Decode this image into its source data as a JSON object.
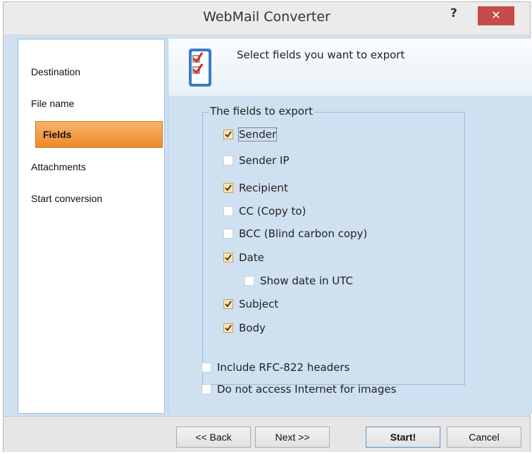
{
  "window": {
    "title": "WebMail Converter",
    "help_label": "?",
    "close_label": "✕"
  },
  "sidebar": {
    "items": [
      {
        "label": "Destination"
      },
      {
        "label": "File name"
      },
      {
        "label": "Fields",
        "active": true
      },
      {
        "label": "Attachments"
      },
      {
        "label": "Start conversion"
      }
    ]
  },
  "header": {
    "icon": "checklist-icon",
    "text": "Select fields you want to export"
  },
  "fields_group": {
    "legend": "The fields to export",
    "options": [
      {
        "label": "Sender",
        "checked": true
      },
      {
        "label": "Sender IP",
        "checked": false
      },
      {
        "label": "Recipient",
        "checked": true
      },
      {
        "label": "CC (Copy to)",
        "checked": false
      },
      {
        "label": "BCC (Blind carbon copy)",
        "checked": false
      },
      {
        "label": "Date",
        "checked": true
      },
      {
        "label": "Show date in UTC",
        "checked": false
      },
      {
        "label": "Subject",
        "checked": true
      },
      {
        "label": "Body",
        "checked": true
      }
    ]
  },
  "extra_options": [
    {
      "label": "Include RFC-822 headers",
      "checked": false
    },
    {
      "label": "Do not access Internet for images",
      "checked": false
    }
  ],
  "buttons": {
    "back": "<< Back",
    "next": "Next >>",
    "start": "Start!",
    "cancel": "Cancel"
  },
  "colors": {
    "accent_orange": "#ee8a2a",
    "close_red": "#c74b4b",
    "panel_blue": "#cfe0f1"
  }
}
